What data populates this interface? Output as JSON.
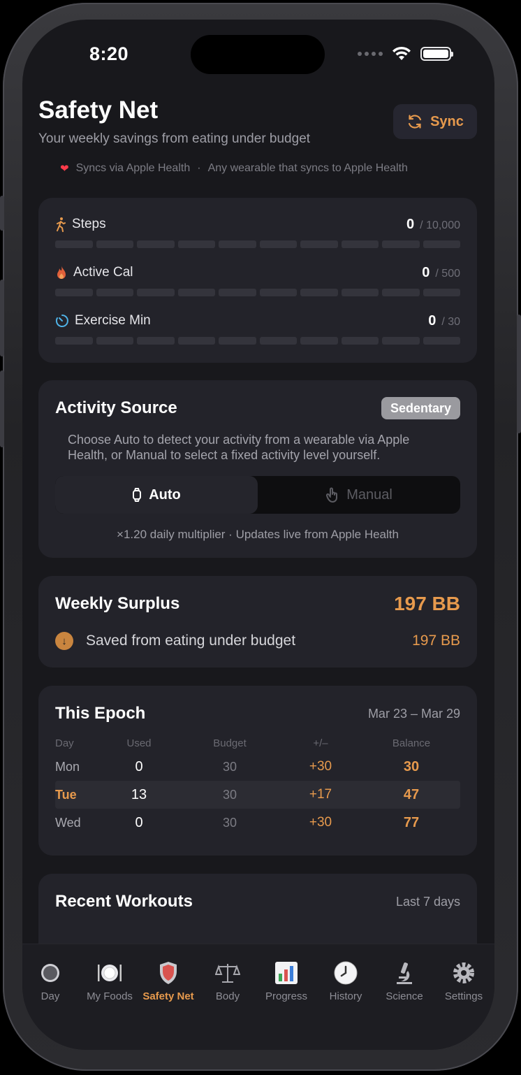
{
  "status": {
    "time": "8:20"
  },
  "header": {
    "title": "Safety Net",
    "subtitle": "Your weekly savings from eating under budget",
    "sync_label": "Sync"
  },
  "health": {
    "source": "Syncs via Apple Health",
    "note": "Any wearable that syncs to Apple Health"
  },
  "metrics": [
    {
      "label": "Steps",
      "value": "0",
      "goal": "/ 10,000",
      "icon": "walking-icon",
      "progress": 0
    },
    {
      "label": "Active Cal",
      "value": "0",
      "goal": "/ 500",
      "icon": "flame-icon",
      "progress": 0
    },
    {
      "label": "Exercise Min",
      "value": "0",
      "goal": "/ 30",
      "icon": "timer-icon",
      "progress": 0
    }
  ],
  "activity": {
    "title": "Activity Source",
    "badge": "Sedentary",
    "description": "Choose Auto to detect your activity from a wearable via Apple Health, or Manual to select a fixed activity level yourself.",
    "auto_label": "Auto",
    "manual_label": "Manual",
    "selected": "Auto",
    "multiplier_text": "×1.20 daily multiplier · Updates live from Apple Health"
  },
  "surplus": {
    "title": "Weekly Surplus",
    "total": "197 BB",
    "line_label": "Saved from eating under budget",
    "line_value": "197 BB"
  },
  "epoch": {
    "title": "This Epoch",
    "range": "Mar 23 – Mar 29",
    "columns": [
      "Day",
      "Used",
      "Budget",
      "+/–",
      "Balance"
    ],
    "rows": [
      {
        "day": "Mon",
        "used": "0",
        "budget": "30",
        "delta": "+30",
        "balance": "30"
      },
      {
        "day": "Tue",
        "used": "13",
        "budget": "30",
        "delta": "+17",
        "balance": "47"
      },
      {
        "day": "Wed",
        "used": "0",
        "budget": "30",
        "delta": "+30",
        "balance": "77"
      }
    ]
  },
  "workouts": {
    "title": "Recent Workouts",
    "range": "Last 7 days"
  },
  "tabs": [
    {
      "label": "Day",
      "icon": "circle-icon"
    },
    {
      "label": "My Foods",
      "icon": "plate-icon"
    },
    {
      "label": "Safety Net",
      "icon": "shield-icon"
    },
    {
      "label": "Body",
      "icon": "scale-icon"
    },
    {
      "label": "Progress",
      "icon": "bar-chart-icon"
    },
    {
      "label": "History",
      "icon": "clock-icon"
    },
    {
      "label": "Science",
      "icon": "microscope-icon"
    },
    {
      "label": "Settings",
      "icon": "gear-icon"
    }
  ],
  "colors": {
    "accent": "#e79a4d",
    "card": "#23232a",
    "background": "#18181c"
  }
}
